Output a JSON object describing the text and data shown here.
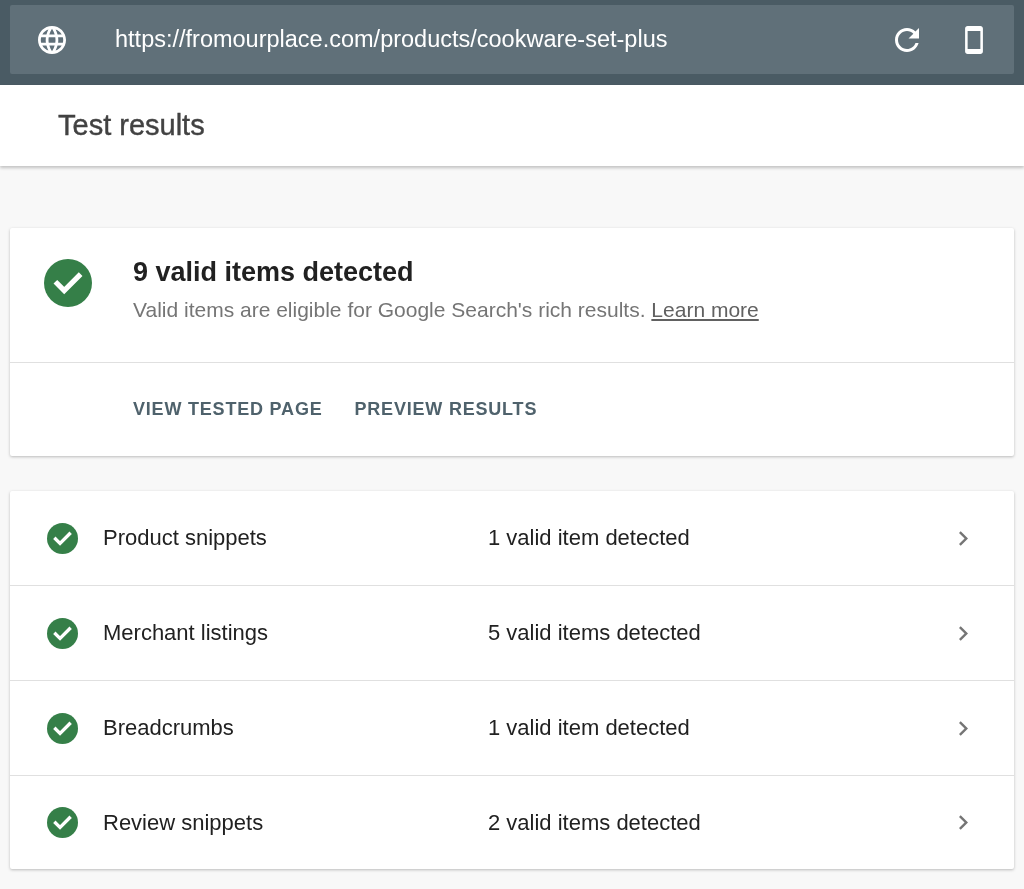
{
  "address_bar": {
    "url": "https://fromourplace.com/products/cookware-set-plus"
  },
  "header": {
    "title": "Test results"
  },
  "summary": {
    "kind": "valid",
    "title": "9 valid items detected",
    "description": "Valid items are eligible for Google Search's rich results.",
    "link": "Learn more",
    "actions": [
      "VIEW TESTED PAGE",
      "PREVIEW RESULTS"
    ]
  },
  "results": [
    {
      "name": "Product snippets",
      "kind": "valid",
      "detail": "1 valid item detected"
    },
    {
      "name": "Merchant listings",
      "kind": "valid",
      "detail": "5 valid items detected"
    },
    {
      "name": "Breadcrumbs",
      "kind": "valid",
      "detail": "1 valid item detected"
    },
    {
      "name": "Review snippets",
      "kind": "valid",
      "detail": "2 valid items detected"
    }
  ]
}
